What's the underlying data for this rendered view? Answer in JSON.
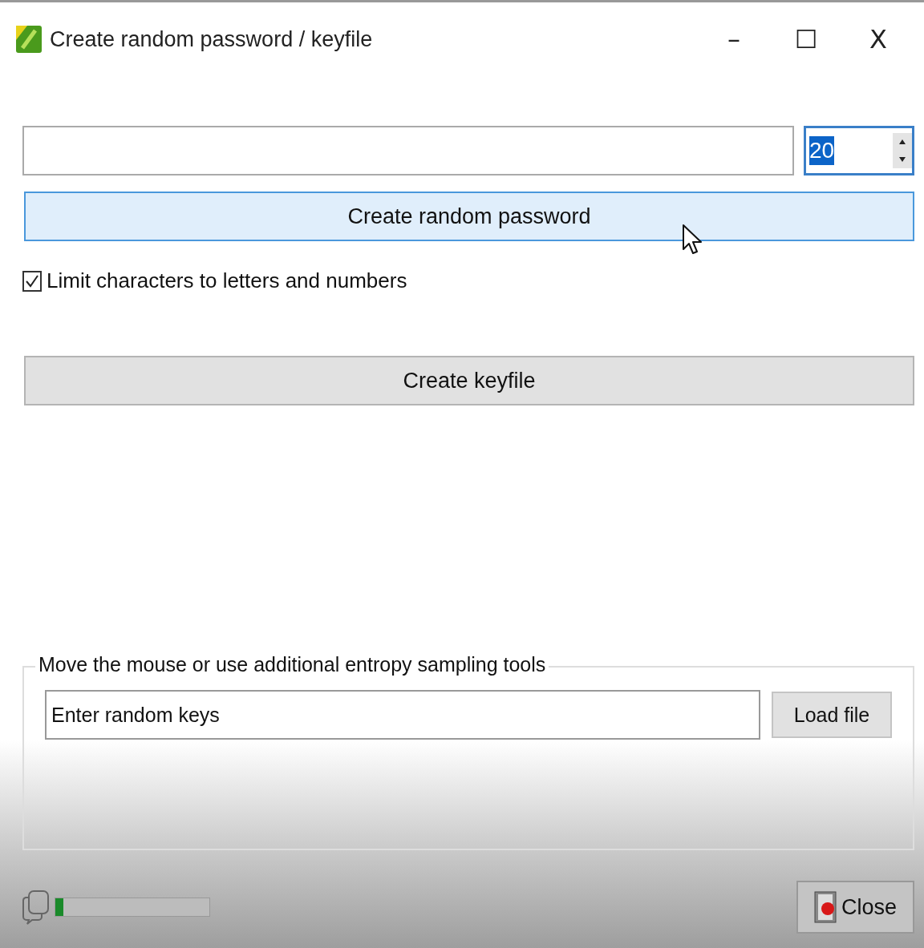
{
  "window": {
    "title": "Create random password / keyfile",
    "controls": [
      "–",
      "☐",
      "X"
    ]
  },
  "length": {
    "value": "20",
    "text_selected": true
  },
  "buttons": [
    {
      "label": "Create random password",
      "hovered": true
    },
    {
      "label": "Create keyfile",
      "hovered": false
    }
  ],
  "limit_option": {
    "label": "Limit characters to letters and numbers",
    "checked": true
  },
  "entropy": {
    "legend": "Move the mouse or use additional entropy sampling tools",
    "keys_value": "Enter random keys",
    "load_button": "Load file"
  },
  "progress": {
    "level": 0.05
  },
  "close_button": "Close"
}
